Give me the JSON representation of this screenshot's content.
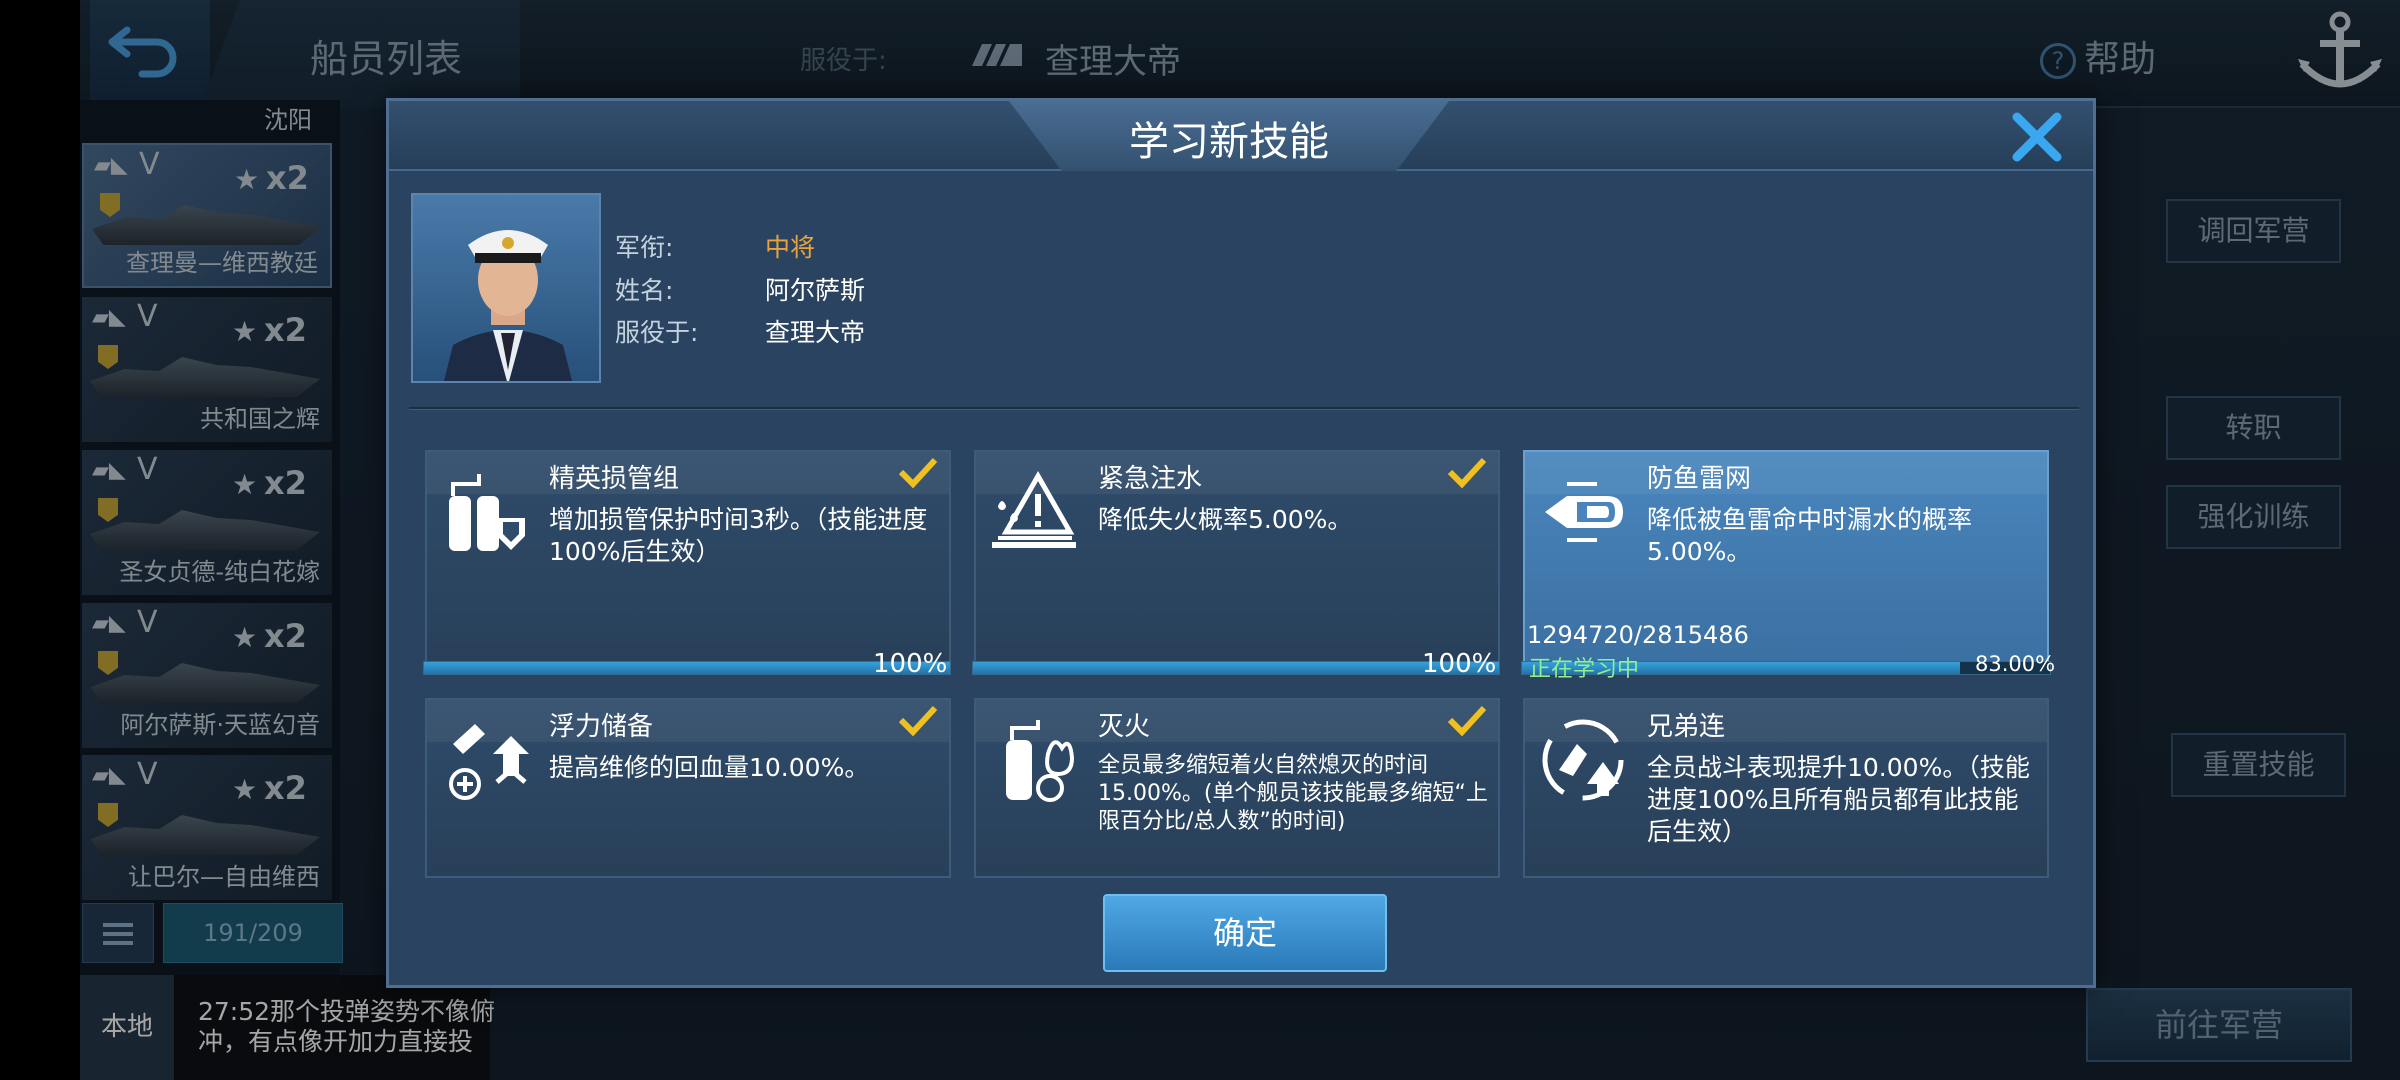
{
  "header": {
    "tab_title": "船员列表",
    "serve_label": "服役于:",
    "serve_ship": "查理大帝",
    "help": "帮助",
    "help_icon": "?"
  },
  "sidebar": {
    "partial_name": "沈阳",
    "ships": [
      {
        "name": "查理曼—维西教廷",
        "flag": "▰◣",
        "grade": "V",
        "count": "x2",
        "selected": true
      },
      {
        "name": "共和国之辉",
        "flag": "▰◣",
        "grade": "V",
        "count": "x2"
      },
      {
        "name": "圣女贞德-纯白花嫁",
        "flag": "▰◣",
        "grade": "V",
        "count": "x2"
      },
      {
        "name": "阿尔萨斯·天蓝幻音",
        "flag": "▰◣",
        "grade": "V",
        "count": "x2"
      },
      {
        "name": "让巴尔—自由维西",
        "flag": "▰◣",
        "grade": "V",
        "count": "x2"
      }
    ],
    "count": "191/209"
  },
  "chat": {
    "channel": "本地",
    "message": "27:52那个投弹姿势不像俯冲，有点像开加力直接投"
  },
  "right_panel": {
    "recall": "调回军营",
    "transfer": "转职",
    "enhance": "强化训练",
    "reset": "重置技能",
    "goto": "前往军营"
  },
  "modal": {
    "title": "学习新技能",
    "officer": {
      "rank_label": "军衔:",
      "rank": "中将",
      "name_label": "姓名:",
      "name": "阿尔萨斯",
      "serve_label": "服役于:",
      "serve": "查理大帝"
    },
    "skills": [
      {
        "title": "精英损管组",
        "desc": "增加损管保护时间3秒。（技能进度100%后生效）",
        "progress_text": "100%",
        "progress": 1.0,
        "done": true,
        "icon": "damage-control-icon"
      },
      {
        "title": "紧急注水",
        "desc": "降低失火概率5.00%。",
        "progress_text": "100%",
        "progress": 1.0,
        "done": true,
        "icon": "flooding-icon"
      },
      {
        "title": "防鱼雷网",
        "desc": "降低被鱼雷命中时漏水的概率5.00%。",
        "xp": "1294720/2815486",
        "status": "正在学习中",
        "progress_text": "83.00%",
        "progress": 0.83,
        "active": true,
        "icon": "torpedo-net-icon"
      },
      {
        "title": "浮力储备",
        "desc": "提高维修的回血量10.00%。",
        "done": true,
        "icon": "buoyancy-icon"
      },
      {
        "title": "灭火",
        "desc": "全员最多缩短着火自然熄灭的时间15.00%。(单个舰员该技能最多缩短“上限百分比/总人数”的时间)",
        "done": true,
        "icon": "fire-extinguish-icon"
      },
      {
        "title": "兄弟连",
        "desc": "全员战斗表现提升10.00%。（技能进度100%且所有船员都有此技能后生效）",
        "icon": "brotherhood-icon"
      }
    ],
    "confirm": "确定"
  },
  "colors": {
    "accent": "#2a7ab8",
    "rank": "#e8a43a",
    "check": "#f0c020",
    "status": "#8ff08f"
  }
}
